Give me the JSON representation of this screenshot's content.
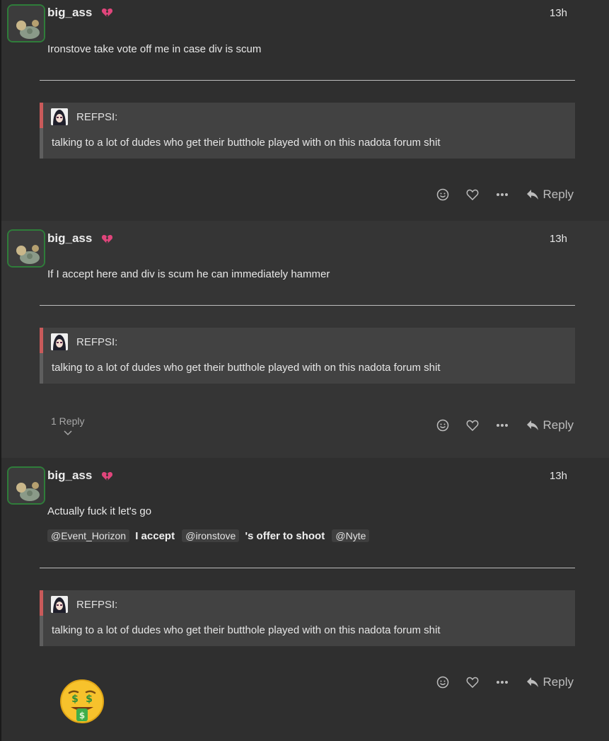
{
  "posts": [
    {
      "username": "big_ass",
      "time": "13h",
      "text": "Ironstove take vote off me in case div is scum",
      "quote": {
        "author": "REFPSI:",
        "text": "talking to a lot of dudes who get their butthole played with on this nadota forum shit"
      },
      "reply_label": "Reply"
    },
    {
      "username": "big_ass",
      "time": "13h",
      "text": "If I accept here and div is scum he can immediately hammer",
      "quote": {
        "author": "REFPSI:",
        "text": "talking to a lot of dudes who get their butthole played with on this nadota forum shit"
      },
      "replies_count": "1 Reply",
      "reply_label": "Reply"
    },
    {
      "username": "big_ass",
      "time": "13h",
      "text": "Actually fuck it let's go",
      "line2": {
        "mention1": "@Event_Horizon",
        "bold1": "I accept",
        "mention2": "@ironstove",
        "bold2": "'s offer to shoot",
        "mention3": "@Nyte"
      },
      "quote": {
        "author": "REFPSI:",
        "text": "talking to a lot of dudes who get their butthole played with on this nadota forum shit"
      },
      "reply_label": "Reply"
    }
  ],
  "icons": {
    "status": "broken-heart-icon",
    "react": "smiley-icon",
    "like": "heart-outline-icon",
    "more": "ellipsis-icon",
    "reply": "reply-arrow-icon",
    "expand": "chevron-down-icon",
    "emoji": "money-mouth-face-icon"
  },
  "colors": {
    "background": "#2f2f2f",
    "quote_bar": "#c95a5a",
    "avatar_border": "#2f7d3a",
    "heart": "#e0457b"
  }
}
